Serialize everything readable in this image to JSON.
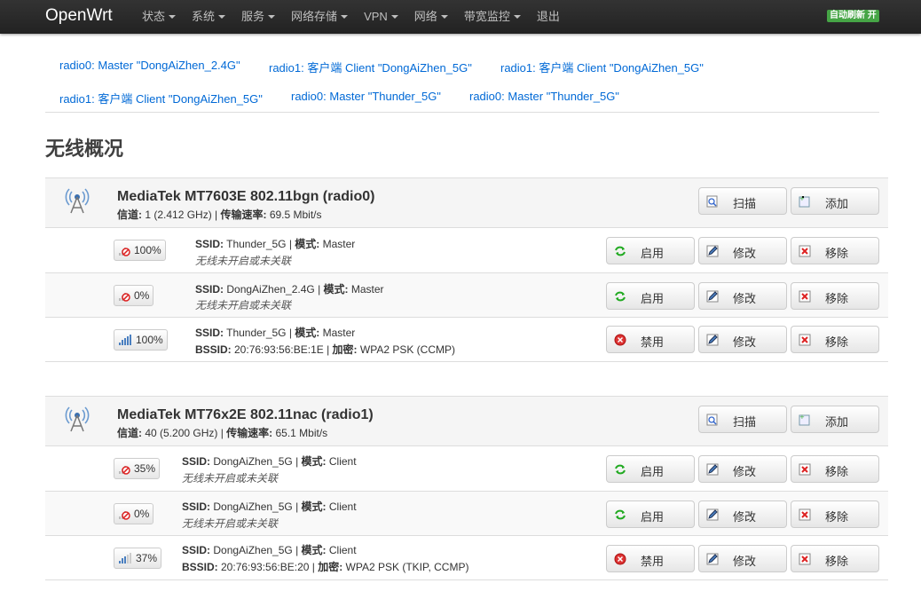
{
  "brand": "OpenWrt",
  "nav": [
    "状态",
    "系统",
    "服务",
    "网络存储",
    "VPN",
    "网络",
    "带宽监控",
    "退出"
  ],
  "auto_refresh": "自动刷新 开",
  "tabs": [
    "radio0: Master \"DongAiZhen_2.4G\"",
    "radio1: 客户端 Client \"DongAiZhen_5G\"",
    "radio1: 客户端 Client \"DongAiZhen_5G\"",
    "radio1: 客户端 Client \"DongAiZhen_5G\"",
    "radio0: Master \"Thunder_5G\"",
    "radio0: Master \"Thunder_5G\""
  ],
  "page_title": "无线概况",
  "labels": {
    "channel": "信道:",
    "rate": "传输速率:",
    "ssid": "SSID:",
    "mode": "模式:",
    "bssid": "BSSID:",
    "enc": "加密:",
    "scan": "扫描",
    "add": "添加",
    "enable": "启用",
    "disable": "禁用",
    "edit": "修改",
    "remove": "移除"
  },
  "devices": [
    {
      "name": "MediaTek MT7603E 802.11bgn (radio0)",
      "channel": " 1 (2.412 GHz) | ",
      "rate": " 69.5 Mbit/s",
      "networks": [
        {
          "signal": "100%",
          "ssid": " Thunder_5G | ",
          "mode": " Master",
          "line2": "无线未开启或未关联",
          "active": false
        },
        {
          "signal": "0%",
          "ssid": " DongAiZhen_2.4G | ",
          "mode": " Master",
          "line2": "无线未开启或未关联",
          "active": false
        },
        {
          "signal": "100%",
          "ssid": " Thunder_5G | ",
          "mode": " Master",
          "bssid": " 20:76:93:56:BE:1E | ",
          "enc": " WPA2 PSK (CCMP)",
          "active": true
        }
      ]
    },
    {
      "name": "MediaTek MT76x2E 802.11nac (radio1)",
      "channel": " 40 (5.200 GHz) | ",
      "rate": " 65.1 Mbit/s",
      "networks": [
        {
          "signal": "35%",
          "ssid": " DongAiZhen_5G | ",
          "mode": " Client",
          "line2": "无线未开启或未关联",
          "active": false
        },
        {
          "signal": "0%",
          "ssid": " DongAiZhen_5G | ",
          "mode": " Client",
          "line2": "无线未开启或未关联",
          "active": false
        },
        {
          "signal": "37%",
          "ssid": " DongAiZhen_5G | ",
          "mode": " Client",
          "bssid": " 20:76:93:56:BE:20 | ",
          "enc": " WPA2 PSK (TKIP, CCMP)",
          "active": true
        }
      ]
    }
  ]
}
